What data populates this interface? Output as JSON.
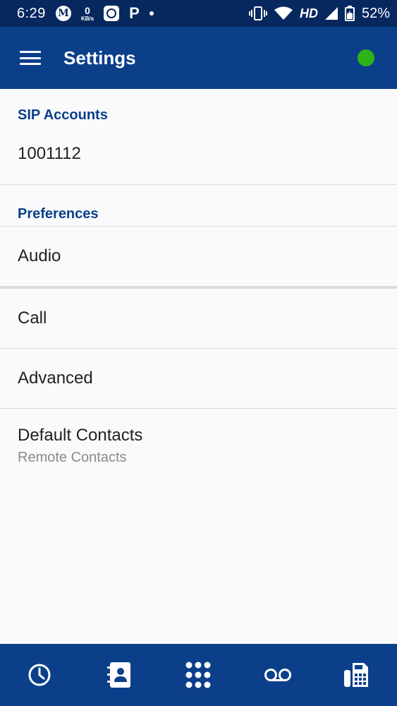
{
  "status_bar": {
    "time": "6:29",
    "m_icon_letter": "M",
    "speed_value": "0",
    "speed_unit": "KB/s",
    "p_icon_letter": "P",
    "network_label": "HD",
    "battery_percent": "52%"
  },
  "app_bar": {
    "title": "Settings",
    "status_color": "#2db319"
  },
  "sections": {
    "sip": {
      "header": "SIP Accounts",
      "account": "1001112"
    },
    "preferences": {
      "header": "Preferences",
      "audio": "Audio",
      "call": "Call",
      "advanced": "Advanced",
      "default_contacts": "Default Contacts",
      "default_contacts_value": "Remote Contacts"
    }
  },
  "bottom_nav": {
    "items": [
      "history-icon",
      "contacts-icon",
      "dialpad-icon",
      "voicemail-icon",
      "fax-icon"
    ]
  },
  "colors": {
    "primary": "#0b3f8a",
    "status_bar": "#07275f",
    "accent_text": "#0b3f8a"
  }
}
